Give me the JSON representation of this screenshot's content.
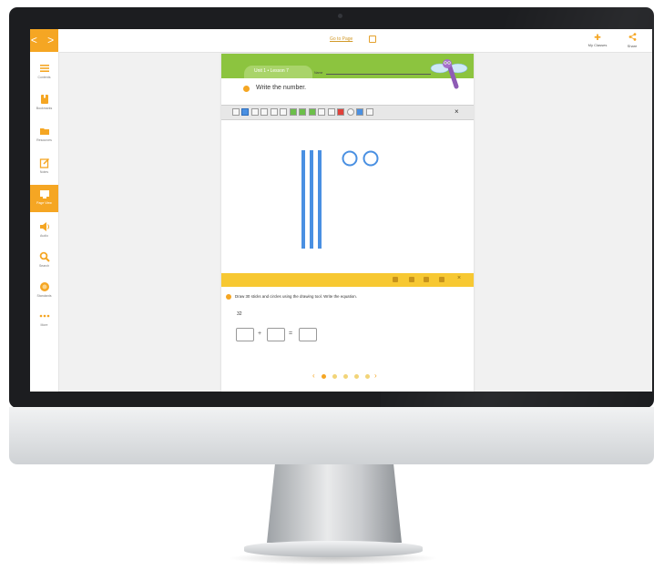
{
  "topbar": {
    "nav_button": "< >",
    "goto_page": "Go to Page",
    "my_classes": "My Classes",
    "share": "Share"
  },
  "sidebar": {
    "items": [
      {
        "label": "Contents",
        "icon": "contents-icon",
        "active": false
      },
      {
        "label": "Bookmarks",
        "icon": "bookmark-icon",
        "active": false
      },
      {
        "label": "Resources",
        "icon": "folder-icon",
        "active": false
      },
      {
        "label": "Notes",
        "icon": "notes-icon",
        "active": false
      },
      {
        "label": "Page View",
        "icon": "page-view-icon",
        "active": true
      },
      {
        "label": "Audio",
        "icon": "speaker-icon",
        "active": false
      },
      {
        "label": "Search",
        "icon": "search-icon",
        "active": false
      },
      {
        "label": "Standards",
        "icon": "standards-icon",
        "active": false
      },
      {
        "label": "More",
        "icon": "more-icon",
        "active": false
      }
    ]
  },
  "document": {
    "lesson_title": "Unit 1 • Lesson 7",
    "name_label": "Name",
    "prompt": "Write the number.",
    "tools": [
      "select-tool-icon",
      "pointer-tool-icon",
      "pen-tool-icon",
      "highlighter-tool-icon",
      "text-tool-icon",
      "stamp-tool-icon",
      "green-tool-icon",
      "green-tool-icon",
      "green-tool-icon",
      "eraser-tool-icon",
      "undo-tool-icon",
      "red-color-icon",
      "color-wheel-icon",
      "blue-color-icon",
      "clear-tool-icon"
    ],
    "close_glyph": "×",
    "drawing": {
      "sticks": 3,
      "circles": 2
    }
  },
  "panel": {
    "close_glyph": "×",
    "instruction": "Draw 30 sticks and circles using the drawing tool. Write the equation.",
    "question_number": "32",
    "plus_sign": "+",
    "equals_sign": "=",
    "pager_prev": "‹",
    "pager_next": "›",
    "pages": 5,
    "current_page": 1
  },
  "colors": {
    "accent": "#f5a623",
    "banner_green": "#8cc43f",
    "panel_yellow": "#f7c832",
    "drawing_blue": "#4a90e2"
  }
}
